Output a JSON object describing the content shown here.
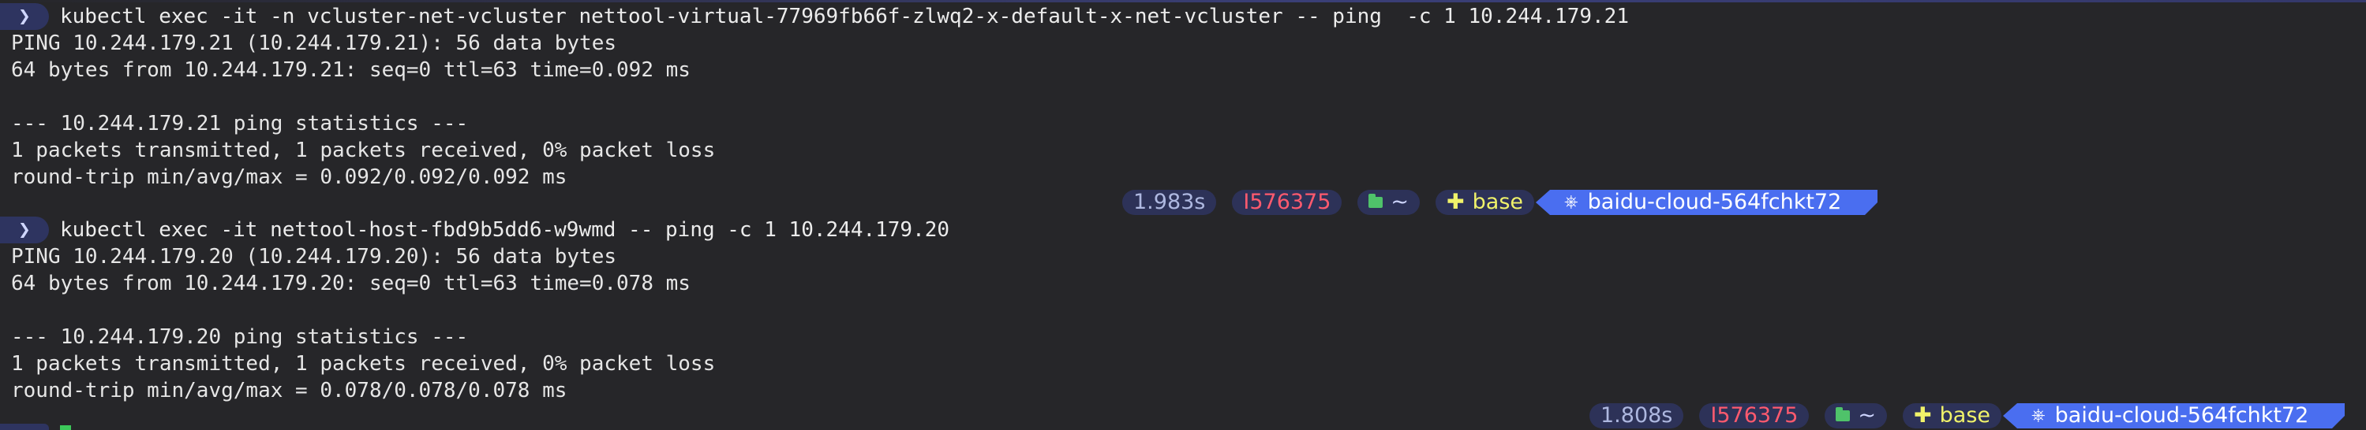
{
  "prompt_symbol": "❯",
  "blocks": [
    {
      "command": "kubectl exec -it -n vcluster-net-vcluster nettool-virtual-77969fb66f-zlwq2-x-default-x-net-vcluster -- ping  -c 1 10.244.179.21",
      "output": [
        "PING 10.244.179.21 (10.244.179.21): 56 data bytes",
        "64 bytes from 10.244.179.21: seq=0 ttl=63 time=0.092 ms",
        "",
        "--- 10.244.179.21 ping statistics ---",
        "1 packets transmitted, 1 packets received, 0% packet loss",
        "round-trip min/avg/max = 0.092/0.092/0.092 ms"
      ],
      "status": {
        "duration": "1.983s",
        "user": "I576375",
        "folder_icon": "folder-icon",
        "dir": "~",
        "env_icon": "plus-icon",
        "env": "base",
        "ctx_icon": "helm-icon",
        "context": "baidu-cloud-564fchkt72"
      }
    },
    {
      "command": "kubectl exec -it nettool-host-fbd9b5dd6-w9wmd -- ping -c 1 10.244.179.20",
      "output": [
        "PING 10.244.179.20 (10.244.179.20): 56 data bytes",
        "64 bytes from 10.244.179.20: seq=0 ttl=63 time=0.078 ms",
        "",
        "--- 10.244.179.20 ping statistics ---",
        "1 packets transmitted, 1 packets received, 0% packet loss",
        "round-trip min/avg/max = 0.078/0.078/0.078 ms"
      ],
      "status": {
        "duration": "1.808s",
        "user": "I576375",
        "folder_icon": "folder-icon",
        "dir": "~",
        "env_icon": "plus-icon",
        "env": "base",
        "ctx_icon": "helm-icon",
        "context": "baidu-cloud-564fchkt72"
      }
    }
  ],
  "colors": {
    "background": "#262629",
    "prompt_bg": "#2e3460",
    "context_bg": "#4a6ef0",
    "user_text": "#ff5a6e",
    "env_text": "#f0f26a",
    "folder_green": "#4fc26a"
  }
}
